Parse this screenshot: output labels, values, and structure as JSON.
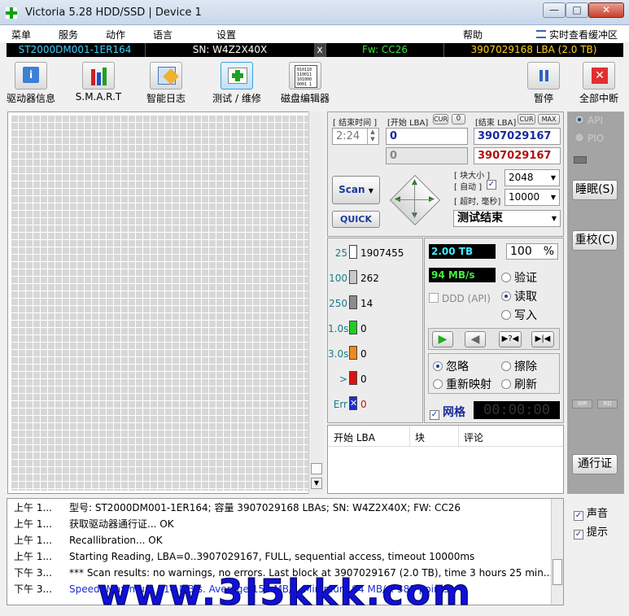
{
  "window": {
    "title": "Victoria 5.28 HDD/SSD | Device 1",
    "min": "—",
    "max": "□",
    "close": "✕"
  },
  "menu": {
    "items": [
      "菜单",
      "服务",
      "动作",
      "语言",
      "设置"
    ],
    "help": "帮助",
    "buffer": "实时查看缓冲区"
  },
  "device": {
    "model": "ST2000DM001-1ER164",
    "sn": "SN: W4Z2X40X",
    "x": "x",
    "fw": "Fw: CC26",
    "lba": "3907029168 LBA (2.0 TB)"
  },
  "toolbar": {
    "drive_info": "驱动器信息",
    "smart": "S.M.A.R.T",
    "smart_log": "智能日志",
    "test": "测试 / 维修",
    "editor": "磁盘编辑器",
    "editor_icon_text": "010110\n110011\n101000\n0001 1",
    "pause": "暂停",
    "abort": "全部中断"
  },
  "scan": {
    "end_time_label": "[ 结束时间 ]",
    "end_time": "2:24",
    "start_lba_label": "[开始 LBA]",
    "cur": "CUR",
    "zero": "0",
    "end_lba_label": "[结束 LBA]",
    "max": "MAX",
    "start_lba": "0",
    "end_lba": "3907029167",
    "cur_lba": "0",
    "cur_end_lba": "3907029167",
    "block_size_label": "[ 块大小 ]",
    "auto_label": "[ 自动 ]",
    "timeout_label": "[ 超时, 毫秒]",
    "block_size": "2048",
    "timeout": "10000",
    "scan_btn": "Scan",
    "quick_btn": "QUICK",
    "status": "测试结束"
  },
  "latency": [
    {
      "label": "25",
      "count": "1907455",
      "color": "#ffffff"
    },
    {
      "label": "100",
      "count": "262",
      "color": "#c8c8c8"
    },
    {
      "label": "250",
      "count": "14",
      "color": "#8c8c8c"
    },
    {
      "label": "1.0s",
      "count": "0",
      "color": "#22cc22"
    },
    {
      "label": "3.0s",
      "count": "0",
      "color": "#f08a1a"
    },
    {
      "label": ">",
      "count": "0",
      "color": "#e01010"
    },
    {
      "label": "Err",
      "count": "0",
      "color": "#1a2fd0"
    }
  ],
  "stats": {
    "size": "2.00 TB",
    "percent": "100",
    "pct_sign": "%",
    "speed": "94 MB/s",
    "ddd": "DDD (API)"
  },
  "mode": {
    "verify": "验证",
    "read": "读取",
    "write": "写入"
  },
  "action": {
    "ignore": "忽略",
    "erase": "擦除",
    "remap": "重新映射",
    "refresh": "刷新"
  },
  "grid_toggle": {
    "label": "网格",
    "timer": "00:00:00"
  },
  "table": {
    "headers": [
      "开始 LBA",
      "块",
      "评论"
    ]
  },
  "side": {
    "api": "API",
    "pio": "PIO",
    "sleep": "睡眠(S)",
    "recal": "重校(C)",
    "wr": "WR",
    "rd": "RD",
    "passport": "通行证"
  },
  "log": [
    {
      "time": "上午 1...",
      "msg": "型号: ST2000DM001-1ER164; 容量 3907029168 LBAs; SN: W4Z2X40X; FW: CC26",
      "color": "#000"
    },
    {
      "time": "上午 1...",
      "msg": "获取驱动器通行证... OK",
      "color": "#000"
    },
    {
      "time": "上午 1...",
      "msg": "Recallibration... OK",
      "color": "#000"
    },
    {
      "time": "上午 1...",
      "msg": "Starting Reading, LBA=0..3907029167, FULL, sequential access, timeout 10000ms",
      "color": "#000"
    },
    {
      "time": "下午 3...",
      "msg": "*** Scan results: no warnings, no errors. Last block at 3907029167 (2.0 TB), time 3 hours 25 min...",
      "color": "#000"
    },
    {
      "time": "下午 3...",
      "msg": "Speed: Maximum 214 MB/s. Average 154 MB/s. Minimum 94 MB/s. 381 points.",
      "color": "#1a2fd0"
    }
  ],
  "bottom": {
    "sound": "声音",
    "hints": "提示"
  },
  "watermark": "www.3l5kkk.com"
}
